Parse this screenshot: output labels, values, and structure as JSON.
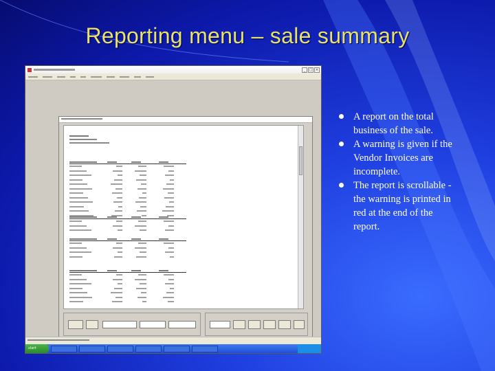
{
  "slide": {
    "title": "Reporting menu – sale summary",
    "bullets": [
      "A report on the total business of the sale.",
      "A warning is given if the Vendor Invoices are incomplete.",
      "The report is scrollable - the warning is printed in red at the end of the report."
    ],
    "colors": {
      "background": "#1f3fe0",
      "title": "#e6e26a",
      "bullet_text": "#ffffff"
    }
  },
  "screenshot": {
    "start_label": "start",
    "controls": [
      "_",
      "□",
      "×"
    ],
    "report_blocks": [
      {
        "rows": 12
      },
      {
        "rows": 3
      },
      {
        "rows": 4
      },
      {
        "rows": 7
      }
    ]
  }
}
